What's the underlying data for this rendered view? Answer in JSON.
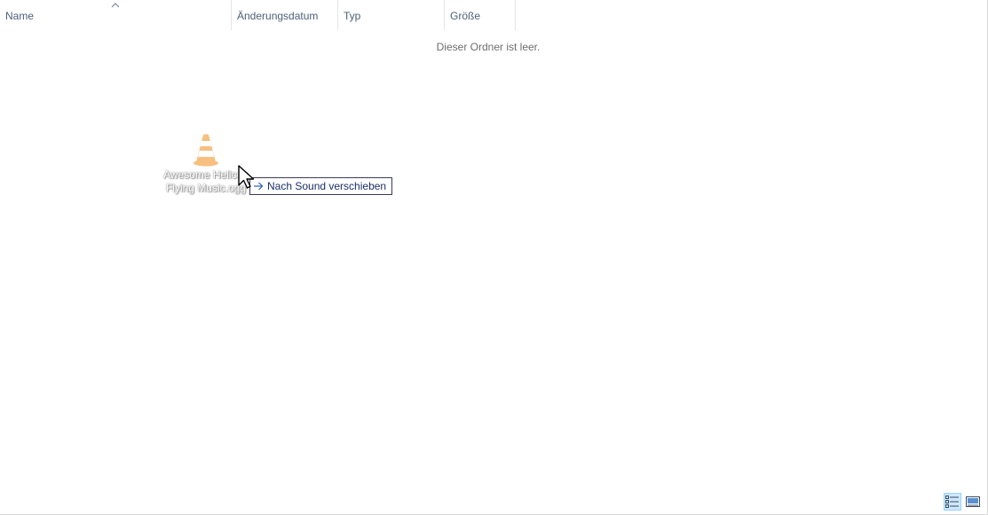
{
  "columns": {
    "name": "Name",
    "modified": "Änderungsdatum",
    "type": "Typ",
    "size": "Größe"
  },
  "sort": {
    "column": "name",
    "direction": "ascending",
    "icon": "sort-up-chevron-icon"
  },
  "empty_message": "Dieser Ordner ist leer.",
  "drag": {
    "file_name_line1": "Awesome Helicop",
    "file_name_line2": "Flying Music.ogg",
    "file_icon": "vlc-cone-icon",
    "drop_tooltip": "Nach Sound verschieben",
    "drop_icon": "move-arrow-icon"
  },
  "cursor": {
    "icon": "arrow-pointer-icon"
  },
  "view_buttons": [
    {
      "name": "details-view",
      "icon": "details-view-icon",
      "active": true
    },
    {
      "name": "large-icons-view",
      "icon": "large-icons-view-icon",
      "active": false
    }
  ],
  "colors": {
    "header_text": "#4c607a",
    "tooltip_text": "#1a2f6b",
    "active_view_bg": "#cce8ff",
    "vlc_orange": "#f28c1a"
  }
}
